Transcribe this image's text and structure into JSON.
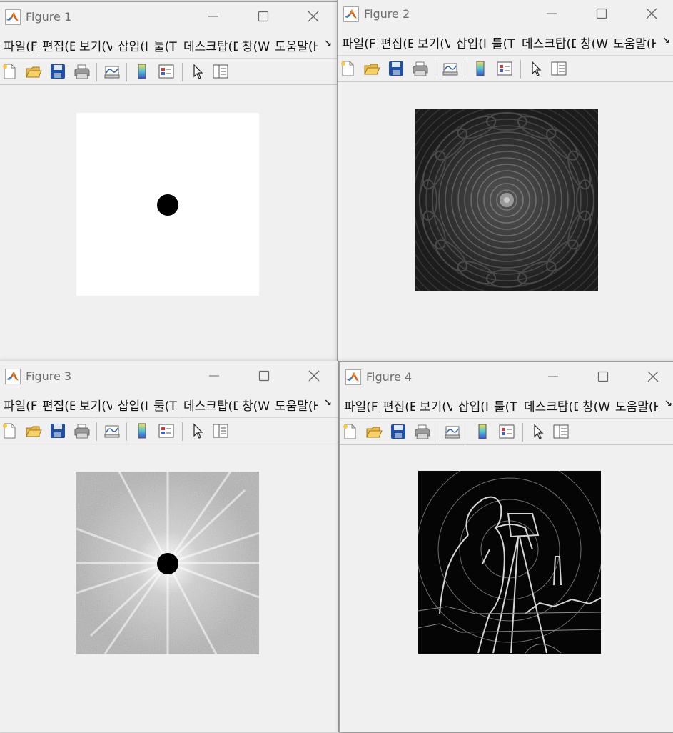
{
  "figures": [
    {
      "title": "Figure 1",
      "menu": [
        "파일(F)",
        "편집(E)",
        "보기(V)",
        "삽입(I)",
        "툴(T)",
        "데스크탑(D)",
        "창(W)",
        "도움말(H)"
      ],
      "icon": "matlab-logo-icon",
      "image": "white background with black circular dot"
    },
    {
      "title": "Figure 2",
      "menu": [
        "파일(F)",
        "편집(E)",
        "보기(V)",
        "삽입(I)",
        "툴(T)",
        "데스크탑(D)",
        "창(W)",
        "도움말(H)"
      ],
      "icon": "matlab-logo-icon",
      "image": "dark ring interference pattern"
    },
    {
      "title": "Figure 3",
      "menu": [
        "파일(F)",
        "편집(E)",
        "보기(V)",
        "삽입(I)",
        "툴(T)",
        "데스크탑(D)",
        "창(W)",
        "도움말(H)"
      ],
      "icon": "matlab-logo-icon",
      "image": "gray noisy spectrum with black dot"
    },
    {
      "title": "Figure 4",
      "menu": [
        "파일(F)",
        "편집(E)",
        "보기(V)",
        "삽입(I)",
        "툴(T)",
        "데스크탑(D)",
        "창(W)",
        "도움말(H)"
      ],
      "icon": "matlab-logo-icon",
      "image": "edge-filtered cameraman photo"
    }
  ],
  "toolbar_icons": [
    "new-figure-icon",
    "open-file-icon",
    "save-icon",
    "print-icon",
    "link-plot-icon",
    "colorbar-icon",
    "legend-icon",
    "edit-plot-arrow-icon",
    "property-inspector-icon"
  ],
  "menu_more_glyph": "↘"
}
